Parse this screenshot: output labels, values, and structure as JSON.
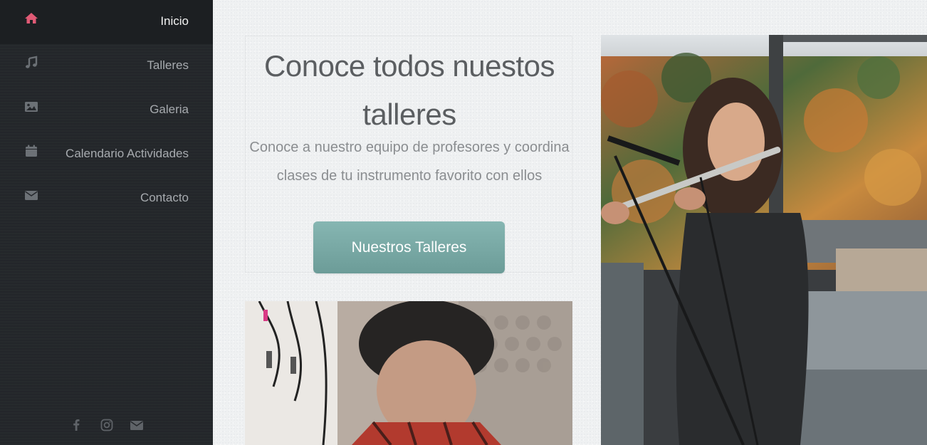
{
  "sidebar": {
    "items": [
      {
        "label": "Inicio",
        "icon": "home-icon",
        "active": true
      },
      {
        "label": "Talleres",
        "icon": "music-note-icon",
        "active": false
      },
      {
        "label": "Galeria",
        "icon": "image-icon",
        "active": false
      },
      {
        "label": "Calendario Actividades",
        "icon": "calendar-icon",
        "active": false
      },
      {
        "label": "Contacto",
        "icon": "envelope-icon",
        "active": false
      }
    ],
    "social": [
      {
        "icon": "facebook-icon"
      },
      {
        "icon": "instagram-icon"
      },
      {
        "icon": "envelope-icon"
      }
    ]
  },
  "hero": {
    "title_line1": "Conoce todos nuestos",
    "title_line2": "talleres",
    "subtitle_line1": "Conoce a nuestro equipo de profesores y coordina",
    "subtitle_line2": "clases de tu instrumento favorito con ellos",
    "button_label": "Nuestros Talleres"
  },
  "colors": {
    "sidebar_bg": "#24272b",
    "active_bg": "#1c1f22",
    "accent_icon": "#e05a75",
    "icon_muted": "#6c7176",
    "button": "#77a6a2",
    "title_text": "#5b5e61"
  }
}
